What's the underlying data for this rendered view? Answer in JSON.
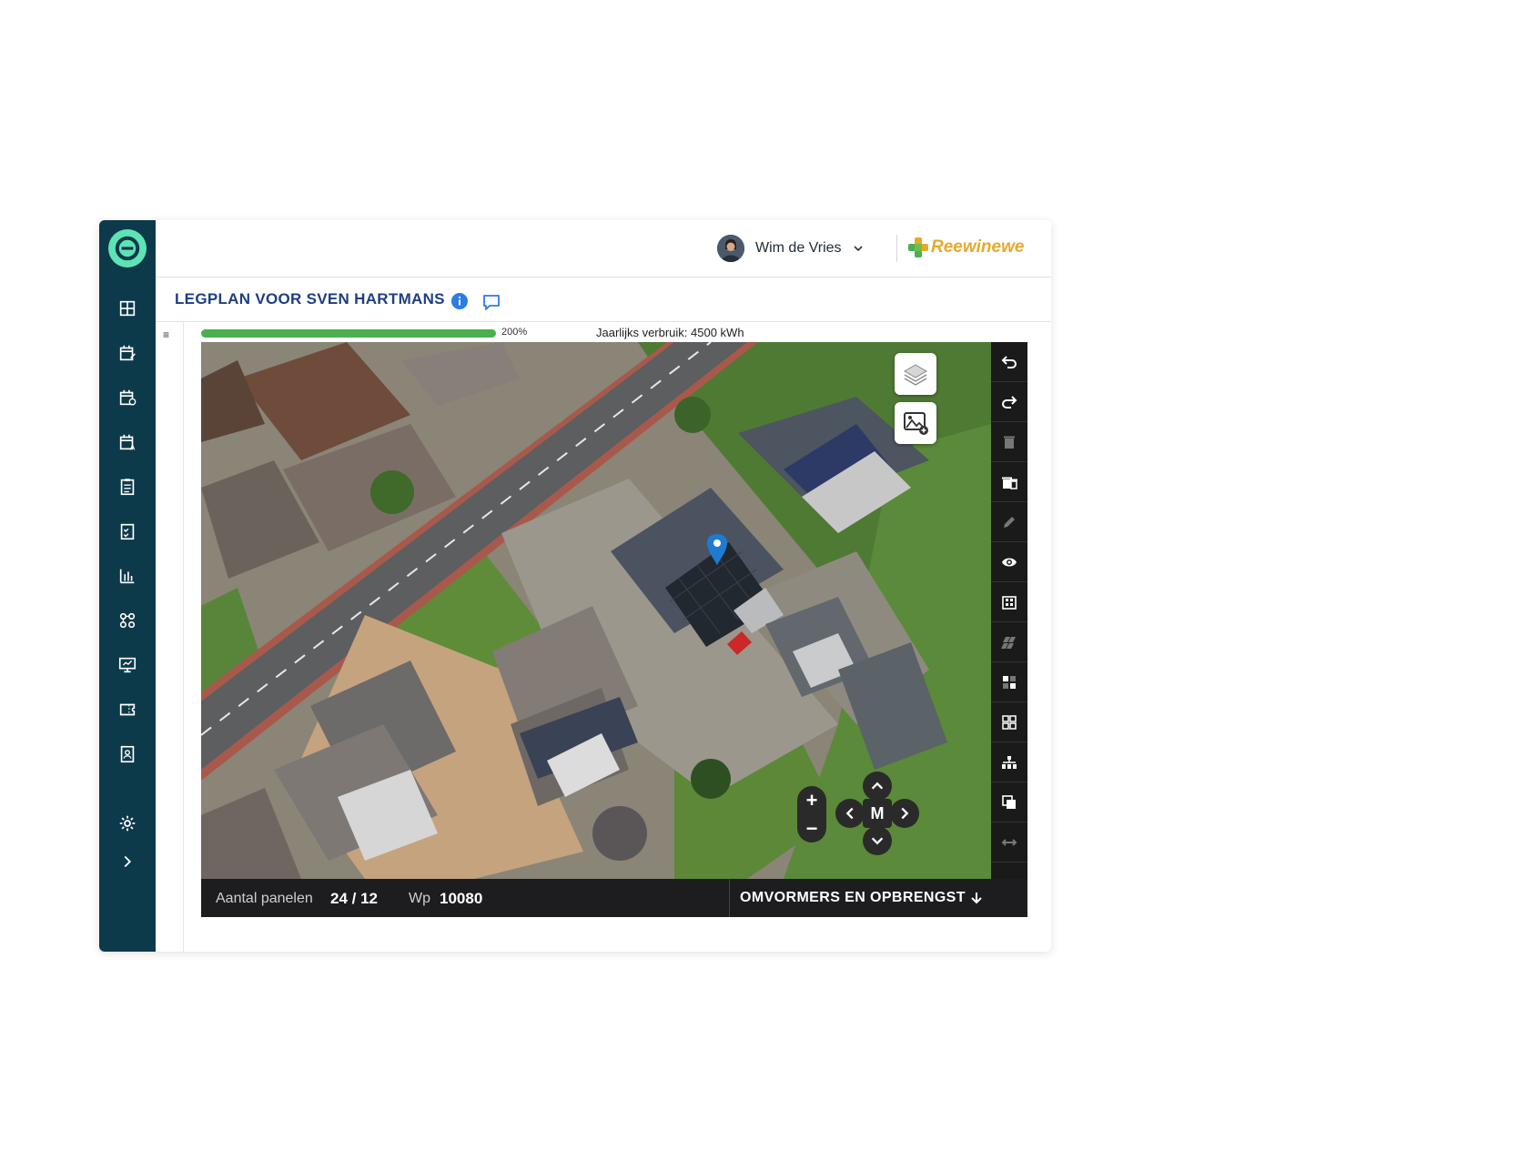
{
  "header": {
    "user_name": "Wim de Vries",
    "brand_name": "Reewinewe"
  },
  "page": {
    "title": "LEGPLAN VOOR SVEN HARTMANS"
  },
  "usage_bar": {
    "percent_label": "200%",
    "fill_fraction": 1.0,
    "annual_usage": "Jaarlijks verbruik: 4500 kWh"
  },
  "map_controls": {
    "center_label": "M",
    "zoom_in": "+",
    "zoom_out": "−"
  },
  "footer": {
    "panels_label": "Aantal panelen",
    "panels_value": "24 / 12",
    "wp_label": "Wp",
    "wp_value": "10080",
    "inverter_button": "OMVORMERS EN OPBRENGST"
  },
  "sidebar": {
    "items": [
      "dashboard-icon",
      "calendar-edit-icon",
      "calendar-check-icon",
      "calendar-user-icon",
      "clipboard-icon",
      "checklist-icon",
      "bar-chart-icon",
      "nodes-icon",
      "presentation-icon",
      "ticket-icon",
      "contact-icon",
      "gear-icon",
      "expand-icon"
    ]
  },
  "toolbar": {
    "tools": [
      "undo-icon",
      "redo-icon",
      "delete-icon",
      "delete-all-icon",
      "edit-icon",
      "eye-icon",
      "panels-grid-icon",
      "parallelogram-icon",
      "layout-icon",
      "grid-icon",
      "hierarchy-icon",
      "copy-icon",
      "measure-icon"
    ]
  },
  "colors": {
    "sidebar": "#0d3a4b",
    "accent": "#5ee3b5",
    "title": "#1e3f80",
    "progress": "#4caf50",
    "brand": "#e6a92a"
  }
}
